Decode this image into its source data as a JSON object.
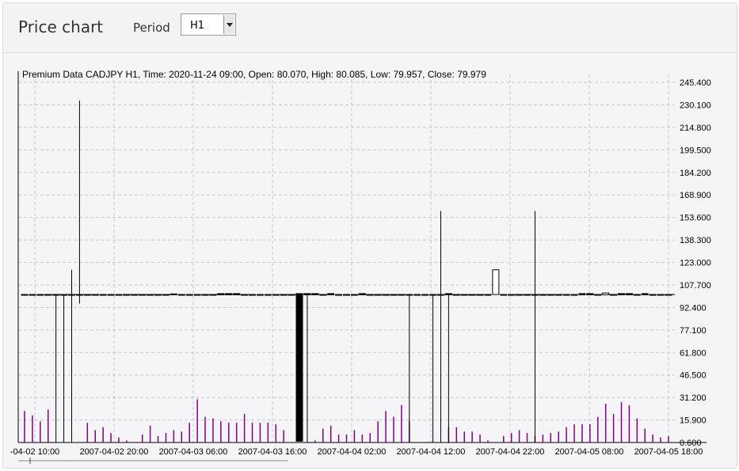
{
  "header": {
    "title": "Price chart",
    "period_label": "Period",
    "period_value": "H1"
  },
  "chart_data": {
    "type": "candlestick",
    "title": "Premium Data CADJPY H1, Time: 2020-11-24 09:00, Open: 80.070, High: 80.085, Low: 79.957, Close: 79.979",
    "y_ticks": [
      "245.400",
      "230.100",
      "214.800",
      "199.500",
      "184.200",
      "168.900",
      "153.600",
      "138.300",
      "123.000",
      "107.700",
      "92.400",
      "77.100",
      "61.800",
      "46.500",
      "31.200",
      "15.900",
      "0.600"
    ],
    "ylim": [
      0.6,
      245.4
    ],
    "x_ticks": [
      "-04-02 10:00",
      "2007-04-02 20:00",
      "2007-04-03 06:00",
      "2007-04-03 16:00",
      "2007-04-04 02:00",
      "2007-04-04 12:00",
      "2007-04-04 22:00",
      "2007-04-05 08:00",
      "2007-04-05 18:00"
    ],
    "grid": true,
    "reference_line": 101.2,
    "candles": [
      {
        "x": 0,
        "o": 101.2,
        "h": 101.2,
        "l": 101.2,
        "c": 101.2
      },
      {
        "x": 1,
        "o": 101.2,
        "h": 101.2,
        "l": 101.2,
        "c": 101.2
      },
      {
        "x": 2,
        "o": 101.2,
        "h": 101.2,
        "l": 101.2,
        "c": 101.2
      },
      {
        "x": 3,
        "o": 101.2,
        "h": 101.2,
        "l": 101.2,
        "c": 101.2
      },
      {
        "x": 4,
        "o": 101.2,
        "h": 101.2,
        "l": 0.6,
        "c": 101.2
      },
      {
        "x": 5,
        "o": 101.2,
        "h": 101.2,
        "l": 0.6,
        "c": 101.2
      },
      {
        "x": 6,
        "o": 101.2,
        "h": 118.0,
        "l": 0.6,
        "c": 101.2
      },
      {
        "x": 7,
        "o": 101.2,
        "h": 233.0,
        "l": 95.0,
        "c": 101.2
      },
      {
        "x": 8,
        "o": 101.2,
        "h": 101.2,
        "l": 101.2,
        "c": 101.2
      },
      {
        "x": 9,
        "o": 101.2,
        "h": 101.2,
        "l": 101.2,
        "c": 101.2
      },
      {
        "x": 10,
        "o": 101.2,
        "h": 101.2,
        "l": 101.2,
        "c": 101.2
      },
      {
        "x": 11,
        "o": 101.2,
        "h": 101.2,
        "l": 101.2,
        "c": 101.2
      },
      {
        "x": 12,
        "o": 101.2,
        "h": 101.2,
        "l": 101.2,
        "c": 101.2
      },
      {
        "x": 13,
        "o": 101.2,
        "h": 101.2,
        "l": 101.2,
        "c": 101.2
      },
      {
        "x": 14,
        "o": 101.2,
        "h": 101.2,
        "l": 101.2,
        "c": 101.2
      },
      {
        "x": 15,
        "o": 101.2,
        "h": 101.2,
        "l": 101.2,
        "c": 101.2
      },
      {
        "x": 16,
        "o": 101.2,
        "h": 101.2,
        "l": 101.2,
        "c": 101.2
      },
      {
        "x": 17,
        "o": 101.2,
        "h": 101.2,
        "l": 101.2,
        "c": 101.2
      },
      {
        "x": 18,
        "o": 101.2,
        "h": 101.2,
        "l": 101.2,
        "c": 101.2
      },
      {
        "x": 19,
        "o": 101.6,
        "h": 101.6,
        "l": 101.0,
        "c": 101.0
      },
      {
        "x": 20,
        "o": 101.2,
        "h": 101.2,
        "l": 101.2,
        "c": 101.2
      },
      {
        "x": 21,
        "o": 101.2,
        "h": 101.2,
        "l": 101.2,
        "c": 101.2
      },
      {
        "x": 22,
        "o": 101.2,
        "h": 101.2,
        "l": 101.2,
        "c": 101.2
      },
      {
        "x": 23,
        "o": 101.2,
        "h": 101.2,
        "l": 101.2,
        "c": 101.2
      },
      {
        "x": 24,
        "o": 101.2,
        "h": 101.2,
        "l": 101.2,
        "c": 101.2
      },
      {
        "x": 25,
        "o": 101.8,
        "h": 101.8,
        "l": 101.0,
        "c": 101.0
      },
      {
        "x": 26,
        "o": 101.8,
        "h": 101.8,
        "l": 101.0,
        "c": 101.0
      },
      {
        "x": 27,
        "o": 101.8,
        "h": 101.8,
        "l": 101.0,
        "c": 101.0
      },
      {
        "x": 28,
        "o": 101.2,
        "h": 101.2,
        "l": 101.2,
        "c": 101.2
      },
      {
        "x": 29,
        "o": 101.2,
        "h": 101.2,
        "l": 101.2,
        "c": 101.2
      },
      {
        "x": 30,
        "o": 101.2,
        "h": 101.2,
        "l": 101.2,
        "c": 101.2
      },
      {
        "x": 31,
        "o": 101.2,
        "h": 101.2,
        "l": 101.2,
        "c": 101.2
      },
      {
        "x": 32,
        "o": 101.2,
        "h": 101.2,
        "l": 101.2,
        "c": 101.2
      },
      {
        "x": 33,
        "o": 101.2,
        "h": 101.2,
        "l": 101.2,
        "c": 101.2
      },
      {
        "x": 34,
        "o": 101.2,
        "h": 101.2,
        "l": 101.2,
        "c": 101.2
      },
      {
        "x": 35,
        "o": 101.8,
        "h": 101.8,
        "l": 1.5,
        "c": 1.5
      },
      {
        "x": 36,
        "o": 101.8,
        "h": 101.8,
        "l": 0.6,
        "c": 101.0
      },
      {
        "x": 37,
        "o": 101.8,
        "h": 101.8,
        "l": 101.0,
        "c": 101.0
      },
      {
        "x": 38,
        "o": 101.2,
        "h": 101.2,
        "l": 101.2,
        "c": 101.2
      },
      {
        "x": 39,
        "o": 101.8,
        "h": 101.8,
        "l": 101.0,
        "c": 101.0
      },
      {
        "x": 40,
        "o": 101.2,
        "h": 101.2,
        "l": 101.2,
        "c": 101.2
      },
      {
        "x": 41,
        "o": 101.2,
        "h": 101.2,
        "l": 101.2,
        "c": 101.2
      },
      {
        "x": 42,
        "o": 101.2,
        "h": 101.2,
        "l": 101.2,
        "c": 101.2
      },
      {
        "x": 43,
        "o": 101.8,
        "h": 101.8,
        "l": 101.0,
        "c": 101.0
      },
      {
        "x": 44,
        "o": 101.2,
        "h": 101.2,
        "l": 101.2,
        "c": 101.2
      },
      {
        "x": 45,
        "o": 101.2,
        "h": 101.2,
        "l": 101.2,
        "c": 101.2
      },
      {
        "x": 46,
        "o": 101.2,
        "h": 101.2,
        "l": 101.2,
        "c": 101.2
      },
      {
        "x": 47,
        "o": 101.2,
        "h": 101.2,
        "l": 101.2,
        "c": 101.2
      },
      {
        "x": 48,
        "o": 101.2,
        "h": 101.2,
        "l": 101.2,
        "c": 101.2
      },
      {
        "x": 49,
        "o": 101.2,
        "h": 101.2,
        "l": 0.6,
        "c": 101.2
      },
      {
        "x": 50,
        "o": 101.2,
        "h": 101.2,
        "l": 101.2,
        "c": 101.2
      },
      {
        "x": 51,
        "o": 101.2,
        "h": 101.2,
        "l": 101.2,
        "c": 101.2
      },
      {
        "x": 52,
        "o": 101.2,
        "h": 101.2,
        "l": 0.6,
        "c": 101.2
      },
      {
        "x": 53,
        "o": 101.2,
        "h": 158.0,
        "l": 0.6,
        "c": 101.2
      },
      {
        "x": 54,
        "o": 101.8,
        "h": 101.8,
        "l": 0.6,
        "c": 101.0
      },
      {
        "x": 55,
        "o": 101.2,
        "h": 101.2,
        "l": 101.2,
        "c": 101.2
      },
      {
        "x": 56,
        "o": 101.2,
        "h": 101.2,
        "l": 101.2,
        "c": 101.2
      },
      {
        "x": 57,
        "o": 101.2,
        "h": 101.2,
        "l": 101.2,
        "c": 101.2
      },
      {
        "x": 58,
        "o": 101.2,
        "h": 101.2,
        "l": 101.2,
        "c": 101.2
      },
      {
        "x": 59,
        "o": 101.2,
        "h": 101.2,
        "l": 101.2,
        "c": 101.2
      },
      {
        "x": 60,
        "o": 101.2,
        "h": 118.0,
        "l": 101.2,
        "c": 118.0
      },
      {
        "x": 61,
        "o": 101.2,
        "h": 101.2,
        "l": 101.2,
        "c": 101.2
      },
      {
        "x": 62,
        "o": 101.2,
        "h": 101.2,
        "l": 101.2,
        "c": 101.2
      },
      {
        "x": 63,
        "o": 101.2,
        "h": 101.2,
        "l": 101.2,
        "c": 101.2
      },
      {
        "x": 64,
        "o": 101.2,
        "h": 101.2,
        "l": 101.2,
        "c": 101.2
      },
      {
        "x": 65,
        "o": 101.2,
        "h": 158.0,
        "l": 0.6,
        "c": 101.2
      },
      {
        "x": 66,
        "o": 101.2,
        "h": 101.2,
        "l": 101.2,
        "c": 101.2
      },
      {
        "x": 67,
        "o": 101.2,
        "h": 101.2,
        "l": 101.2,
        "c": 101.2
      },
      {
        "x": 68,
        "o": 101.2,
        "h": 101.2,
        "l": 101.2,
        "c": 101.2
      },
      {
        "x": 69,
        "o": 101.2,
        "h": 101.2,
        "l": 101.2,
        "c": 101.2
      },
      {
        "x": 70,
        "o": 101.2,
        "h": 101.2,
        "l": 101.2,
        "c": 101.2
      },
      {
        "x": 71,
        "o": 101.8,
        "h": 101.8,
        "l": 101.0,
        "c": 101.0
      },
      {
        "x": 72,
        "o": 101.8,
        "h": 101.8,
        "l": 101.0,
        "c": 101.0
      },
      {
        "x": 73,
        "o": 101.2,
        "h": 101.2,
        "l": 101.2,
        "c": 101.2
      },
      {
        "x": 74,
        "o": 101.0,
        "h": 102.2,
        "l": 101.0,
        "c": 102.2
      },
      {
        "x": 75,
        "o": 101.2,
        "h": 101.2,
        "l": 101.2,
        "c": 101.2
      },
      {
        "x": 76,
        "o": 101.8,
        "h": 101.8,
        "l": 101.0,
        "c": 101.0
      },
      {
        "x": 77,
        "o": 101.8,
        "h": 101.8,
        "l": 101.0,
        "c": 101.0
      },
      {
        "x": 78,
        "o": 101.2,
        "h": 101.2,
        "l": 101.2,
        "c": 101.2
      },
      {
        "x": 79,
        "o": 101.8,
        "h": 101.8,
        "l": 101.0,
        "c": 101.0
      },
      {
        "x": 80,
        "o": 101.2,
        "h": 101.2,
        "l": 101.2,
        "c": 101.2
      },
      {
        "x": 81,
        "o": 101.2,
        "h": 101.2,
        "l": 101.2,
        "c": 101.2
      },
      {
        "x": 82,
        "o": 101.2,
        "h": 101.2,
        "l": 101.2,
        "c": 101.2
      }
    ],
    "volume": [
      22,
      19,
      15,
      23,
      0,
      0,
      0,
      0,
      14,
      9,
      11,
      7,
      4,
      2,
      1,
      6,
      12,
      5,
      7,
      9,
      8,
      14,
      30,
      18,
      17,
      15,
      14,
      14,
      20,
      14,
      14,
      14,
      13,
      9,
      0,
      0,
      0,
      2,
      10,
      12,
      6,
      6,
      9,
      6,
      7,
      15,
      22,
      18,
      26,
      15,
      0,
      0,
      0,
      0,
      11,
      11,
      8,
      8,
      6,
      2,
      0,
      5,
      7,
      9,
      7,
      5,
      6,
      7,
      8,
      11,
      13,
      13,
      13,
      18,
      27,
      20,
      28,
      26,
      17,
      10,
      6,
      4,
      5
    ],
    "colors": {
      "candle": "#000000",
      "volume": "#800080",
      "grid": "#c8c8c8",
      "background": "#f5f5f7"
    }
  }
}
